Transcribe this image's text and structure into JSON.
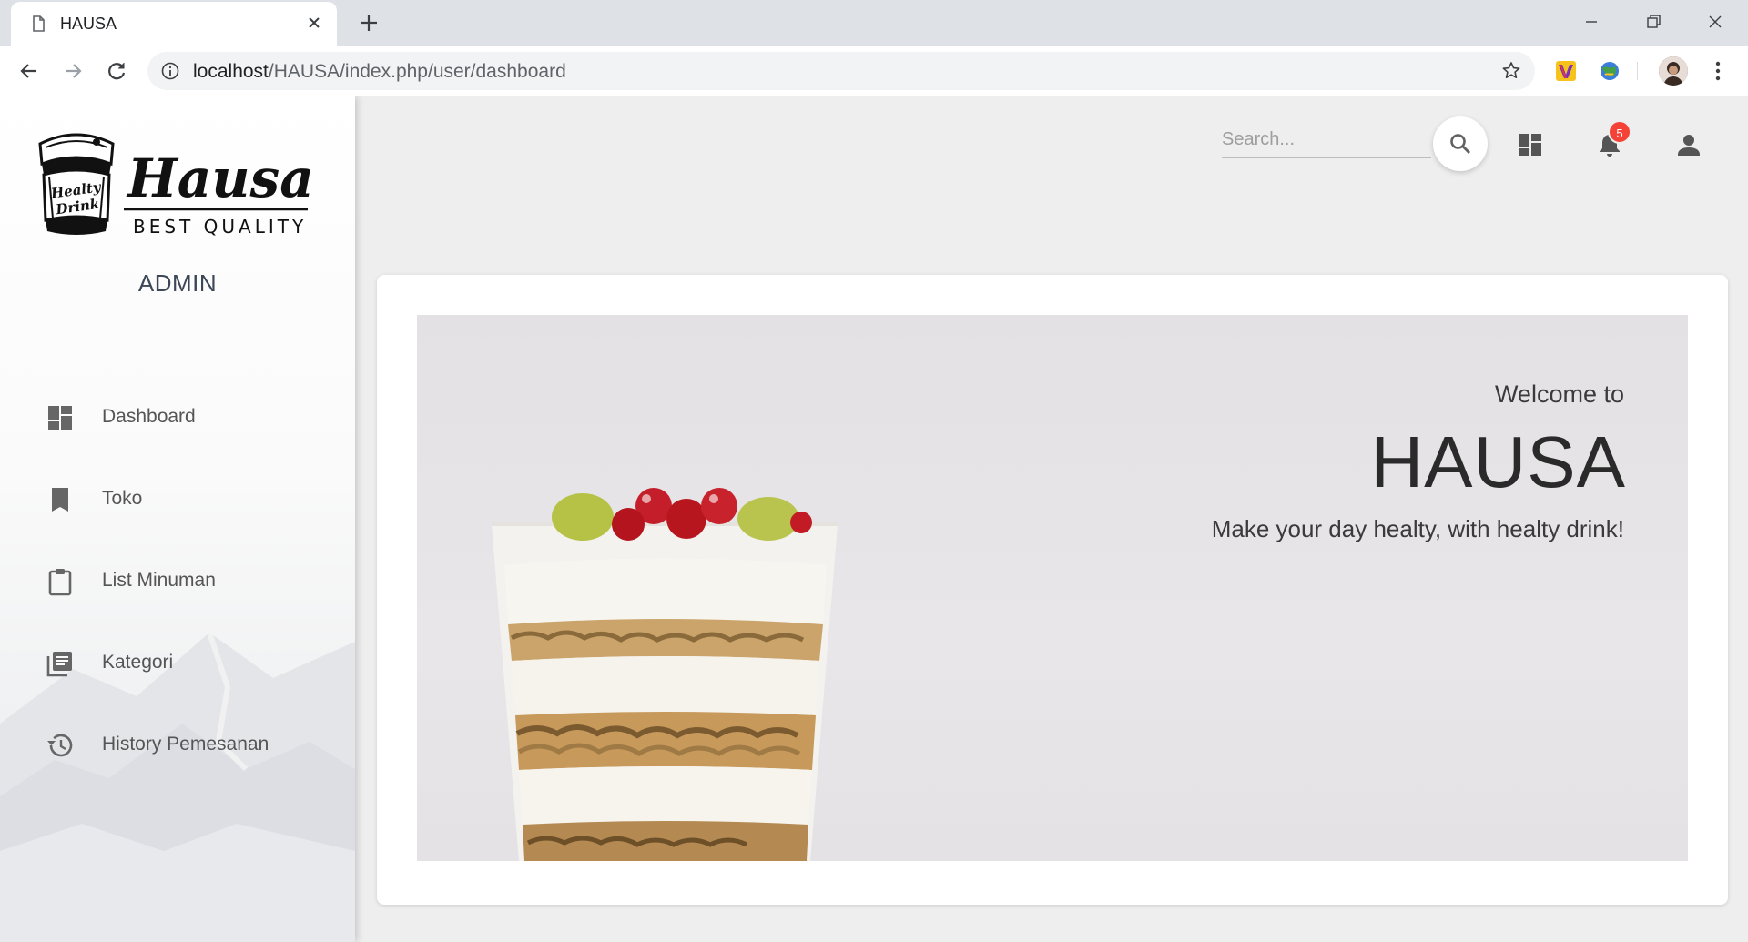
{
  "browser": {
    "tab_title": "HAUSA",
    "url_host": "localhost",
    "url_path": "/HAUSA/index.php/user/dashboard"
  },
  "sidebar": {
    "logo": {
      "brand": "Hausa",
      "tagline": "BEST QUALITY",
      "badge_line1": "Healty",
      "badge_line2": "Drink"
    },
    "role": "ADMIN",
    "items": [
      {
        "label": "Dashboard",
        "icon": "dashboard-icon"
      },
      {
        "label": "Toko",
        "icon": "bookmark-icon"
      },
      {
        "label": "List Minuman",
        "icon": "clipboard-icon"
      },
      {
        "label": "Kategori",
        "icon": "library-books-icon"
      },
      {
        "label": "History Pemesanan",
        "icon": "history-icon"
      }
    ]
  },
  "header": {
    "search_placeholder": "Search...",
    "notification_count": "5"
  },
  "hero": {
    "welcome": "Welcome to",
    "title": "HAUSA",
    "tagline": "Make your day healty, with healty drink!"
  },
  "colors": {
    "badge": "#f44336",
    "menu_text": "#555555",
    "background": "#eeeeee"
  }
}
